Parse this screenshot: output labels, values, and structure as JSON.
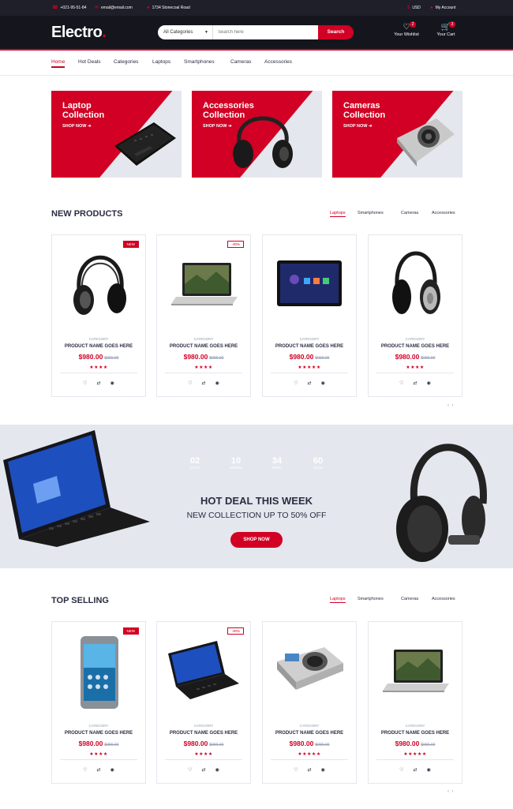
{
  "topbar": {
    "phone": "+021-95-51-84",
    "email": "email@email.com",
    "address": "1734 Stonecoal Road",
    "currency": "USD",
    "account": "My Account"
  },
  "header": {
    "logo_text": "Electro",
    "logo_dot": ".",
    "search": {
      "category": "All Categories",
      "placeholder": "Search here",
      "button": "Search"
    },
    "wishlist": {
      "label": "Your Wishlist",
      "count": "2"
    },
    "cart": {
      "label": "Your Cart",
      "count": "3"
    }
  },
  "nav": [
    "Home",
    "Hot Deals",
    "Categories",
    "Laptops",
    "Smartphones",
    "Cameras",
    "Accessories"
  ],
  "collections": [
    {
      "title": "Laptop Collection",
      "cta": "SHOP NOW"
    },
    {
      "title": "Accessories Collection",
      "cta": "SHOP NOW"
    },
    {
      "title": "Cameras Collection",
      "cta": "SHOP NOW"
    }
  ],
  "new_products": {
    "title": "NEW PRODUCTS",
    "tabs": [
      "Laptops",
      "Smartphones",
      "Cameras",
      "Accessories"
    ],
    "items": [
      {
        "badge": "NEW",
        "category": "CATEGORY",
        "name": "PRODUCT NAME GOES HERE",
        "price": "$980.00",
        "old_price": "$990.00",
        "stars": "★★★★",
        "image": "headphones"
      },
      {
        "badge": "-30%",
        "category": "CATEGORY",
        "name": "PRODUCT NAME GOES HERE",
        "price": "$980.00",
        "old_price": "$990.00",
        "stars": "★★★★",
        "image": "laptop"
      },
      {
        "badge": "",
        "category": "CATEGORY",
        "name": "PRODUCT NAME GOES HERE",
        "price": "$980.00",
        "old_price": "$990.00",
        "stars": "★★★★★",
        "image": "tablet"
      },
      {
        "badge": "",
        "category": "CATEGORY",
        "name": "PRODUCT NAME GOES HERE",
        "price": "$980.00",
        "old_price": "$990.00",
        "stars": "★★★★",
        "image": "headphones-silver"
      }
    ]
  },
  "hot_deal": {
    "countdown": [
      {
        "value": "02",
        "unit": "DAYS"
      },
      {
        "value": "10",
        "unit": "HOURS"
      },
      {
        "value": "34",
        "unit": "MINS"
      },
      {
        "value": "60",
        "unit": "SECS"
      }
    ],
    "heading": "HOT DEAL THIS WEEK",
    "subheading": "NEW COLLECTION UP TO 50% OFF",
    "button": "SHOP NOW"
  },
  "top_selling": {
    "title": "TOP SELLING",
    "tabs": [
      "Laptops",
      "Smartphones",
      "Cameras",
      "Accessories"
    ],
    "items": [
      {
        "badge": "NEW",
        "category": "CATEGORY",
        "name": "PRODUCT NAME GOES HERE",
        "price": "$980.00",
        "old_price": "$990.00",
        "stars": "★★★★",
        "image": "phone"
      },
      {
        "badge": "-30%",
        "category": "CATEGORY",
        "name": "PRODUCT NAME GOES HERE",
        "price": "$980.00",
        "old_price": "$990.00",
        "stars": "★★★★",
        "image": "laptop-dark"
      },
      {
        "badge": "",
        "category": "CATEGORY",
        "name": "PRODUCT NAME GOES HERE",
        "price": "$980.00",
        "old_price": "$990.00",
        "stars": "★★★★★",
        "image": "camera"
      },
      {
        "badge": "",
        "category": "CATEGORY",
        "name": "PRODUCT NAME GOES HERE",
        "price": "$980.00",
        "old_price": "$990.00",
        "stars": "★★★★★",
        "image": "laptop"
      }
    ]
  },
  "colors": {
    "accent": "#d10024",
    "dark": "#15161d",
    "topbar": "#1e1f29",
    "light": "#e4e7ed",
    "text": "#2b2d42"
  }
}
